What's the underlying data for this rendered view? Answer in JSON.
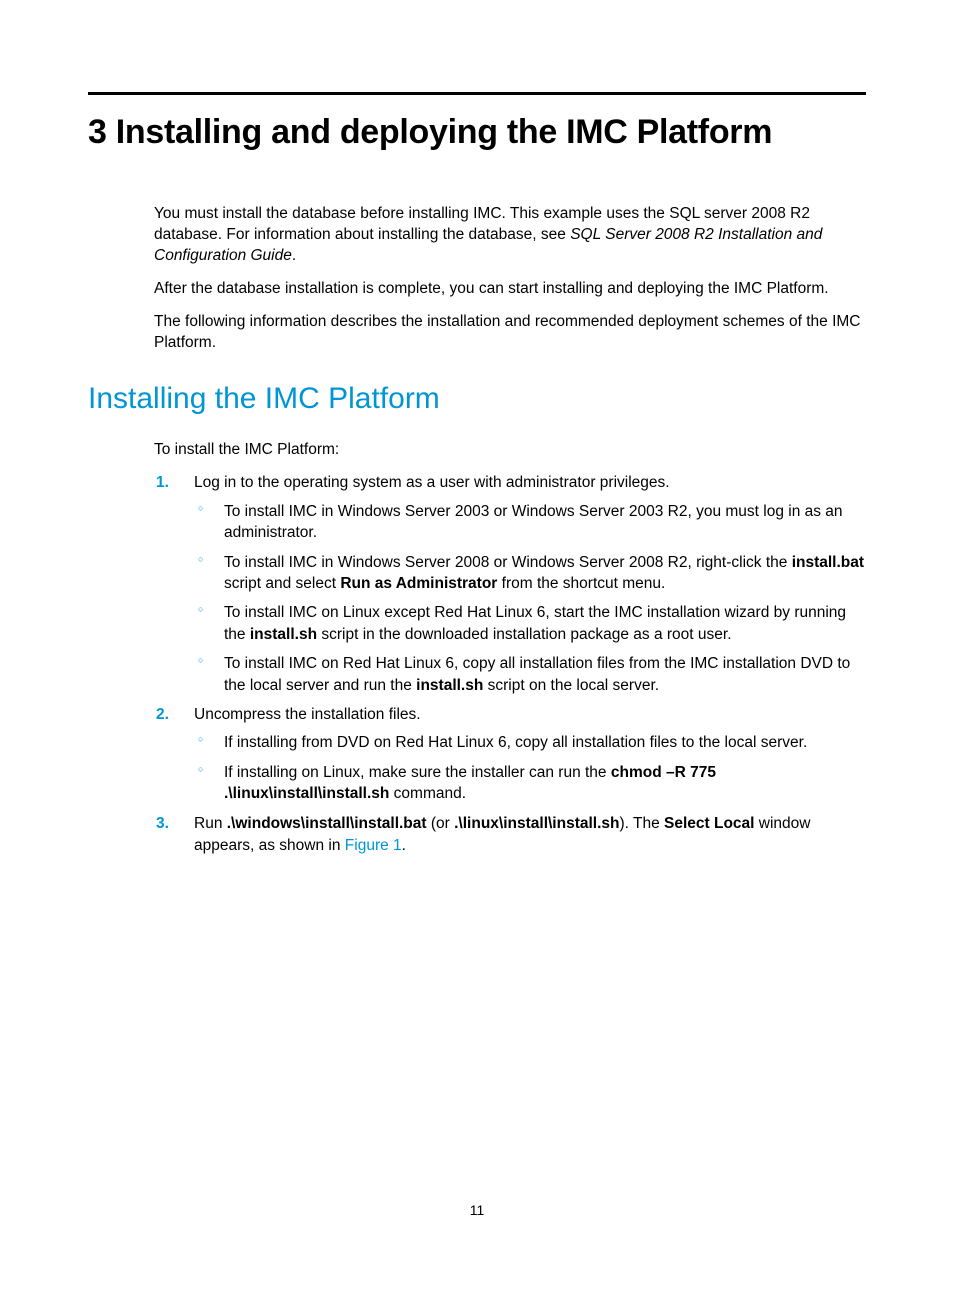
{
  "chapter": {
    "title": "3 Installing and deploying the IMC Platform"
  },
  "intro": {
    "p1_pre": "You must install the database before installing IMC. This example uses the SQL server 2008 R2 database. For information about installing the database, see ",
    "p1_italic": "SQL Server 2008 R2 Installation and Configuration Guide",
    "p1_post": ".",
    "p2": "After the database installation is complete, you can start installing and deploying the IMC Platform.",
    "p3": "The following information describes the installation and recommended deployment schemes of the IMC Platform."
  },
  "section": {
    "title": "Installing the IMC Platform",
    "lead": "To install the IMC Platform:"
  },
  "steps": {
    "s1": {
      "num": "1.",
      "text": "Log in to the operating system as a user with administrator privileges.",
      "sub": {
        "a": "To install IMC in Windows Server 2003 or Windows Server 2003 R2, you must log in as an administrator.",
        "b_pre": "To install IMC in Windows Server 2008 or Windows Server 2008 R2, right-click the ",
        "b_bold1": "install.bat",
        "b_mid": " script and select ",
        "b_bold2": "Run as Administrator",
        "b_post": " from the shortcut menu.",
        "c_pre": "To install IMC on Linux except Red Hat Linux 6, start the IMC installation wizard by running the ",
        "c_bold": "install.sh",
        "c_post": " script in the downloaded installation package as a root user.",
        "d_pre": "To install IMC on Red Hat Linux 6, copy all installation files from the IMC installation DVD to the local server and run the ",
        "d_bold": "install.sh",
        "d_post": " script on the local server."
      }
    },
    "s2": {
      "num": "2.",
      "text": "Uncompress the installation files.",
      "sub": {
        "a": "If installing from DVD on Red Hat Linux 6, copy all installation files to the local server.",
        "b_pre": "If installing on Linux, make sure the installer can run the ",
        "b_bold": "chmod –R 775 .\\linux\\install\\install.sh",
        "b_post": " command."
      }
    },
    "s3": {
      "num": "3.",
      "pre": "Run ",
      "bold1": ".\\windows\\install\\install.bat",
      "mid1": " (or ",
      "bold2": ".\\linux\\install\\install.sh",
      "mid2": "). The ",
      "bold3": "Select Local",
      "mid3": " window appears, as shown in ",
      "link": "Figure 1",
      "post": "."
    }
  },
  "page_number": "11"
}
